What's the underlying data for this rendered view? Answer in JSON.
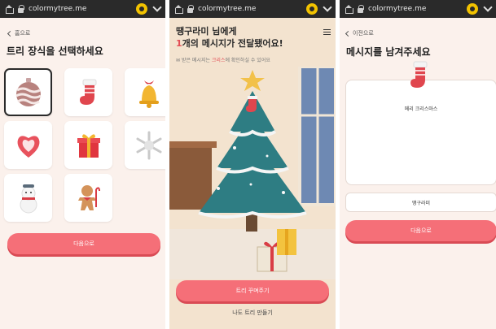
{
  "browser": {
    "url": "colormytree.me"
  },
  "screen1": {
    "back_label": "홈으로",
    "title": "트리 장식을 선택하세요",
    "decorations": [
      "ornament-ball-icon",
      "stocking-icon",
      "bell-icon",
      "heart-icon",
      "gift-icon",
      "snowflake-icon",
      "snowman-icon",
      "gingerbread-icon"
    ],
    "next_button": "다음으로"
  },
  "screen2": {
    "title_line1": "땡구라미 님에게",
    "count": "1",
    "title_line2_rest": "개의 메시지가 전달됐어요!",
    "sub_prefix": "받은 메시지는",
    "sub_highlight": "크리스",
    "sub_suffix": "에 확인하실 수 있어요",
    "decorate_button": "트리 꾸며주기",
    "make_tree_link": "나도 트리 만들기"
  },
  "screen3": {
    "back_label": "이전으로",
    "title": "메시지를 남겨주세요",
    "message": "메리 크리스마스",
    "name": "땡구라미",
    "next_button": "다음으로"
  },
  "colors": {
    "accent": "#f56f78",
    "accent_shadow": "#d94b55",
    "tree": "#2e7d83",
    "background": "#fbf1ec"
  }
}
